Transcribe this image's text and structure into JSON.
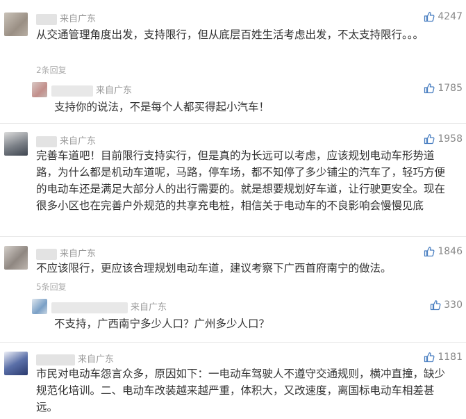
{
  "comments": [
    {
      "source": "来自广东",
      "likes": "4247",
      "text": "从交通管理角度出发，支持限行，但从底层百姓生活考虑出发，不太支持限行。。。",
      "reply_count": "2条回复",
      "replies": [
        {
          "source": "来自广东",
          "likes": "1785",
          "text": "支持你的说法，不是每个人都买得起小汽车！"
        }
      ]
    },
    {
      "source": "来自广东",
      "likes": "1958",
      "text": "完善车道吧！目前限行支持实行，但是真的为长远可以考虑，应该规划电动车形势道路，为什么都是机动车道呢，马路，停车场，都不知停了多少铺尘的汽车了，轻巧方便的电动车还是满足大部分人的出行需要的。就是想要规划好车道，让行驶更安全。现在很多小区也在完善户外规范的共享充电桩，相信关于电动车的不良影响会慢慢见底"
    },
    {
      "source": "来自广东",
      "likes": "1846",
      "text": "不应该限行，更应该合理规划电动车道，建议考察下广西首府南宁的做法。",
      "reply_count": "5条回复",
      "replies": [
        {
          "source": "来自广东",
          "likes": "330",
          "text": "不支持，广西南宁多少人口？广州多少人口？"
        }
      ]
    },
    {
      "source": "来自广东",
      "likes": "1181",
      "text": "市民对电动车怨言众多，原因如下：一电动车驾驶人不遵守交通规则，横冲直撞，缺少规范化培训。二、电动车改装越来越严重，体积大，又改速度，离国标电动车相差甚远。"
    }
  ],
  "icons": {
    "like": "thumbs-up-icon"
  },
  "colors": {
    "like_icon": "#4a7fc1",
    "meta": "#999999",
    "text": "#333333"
  }
}
